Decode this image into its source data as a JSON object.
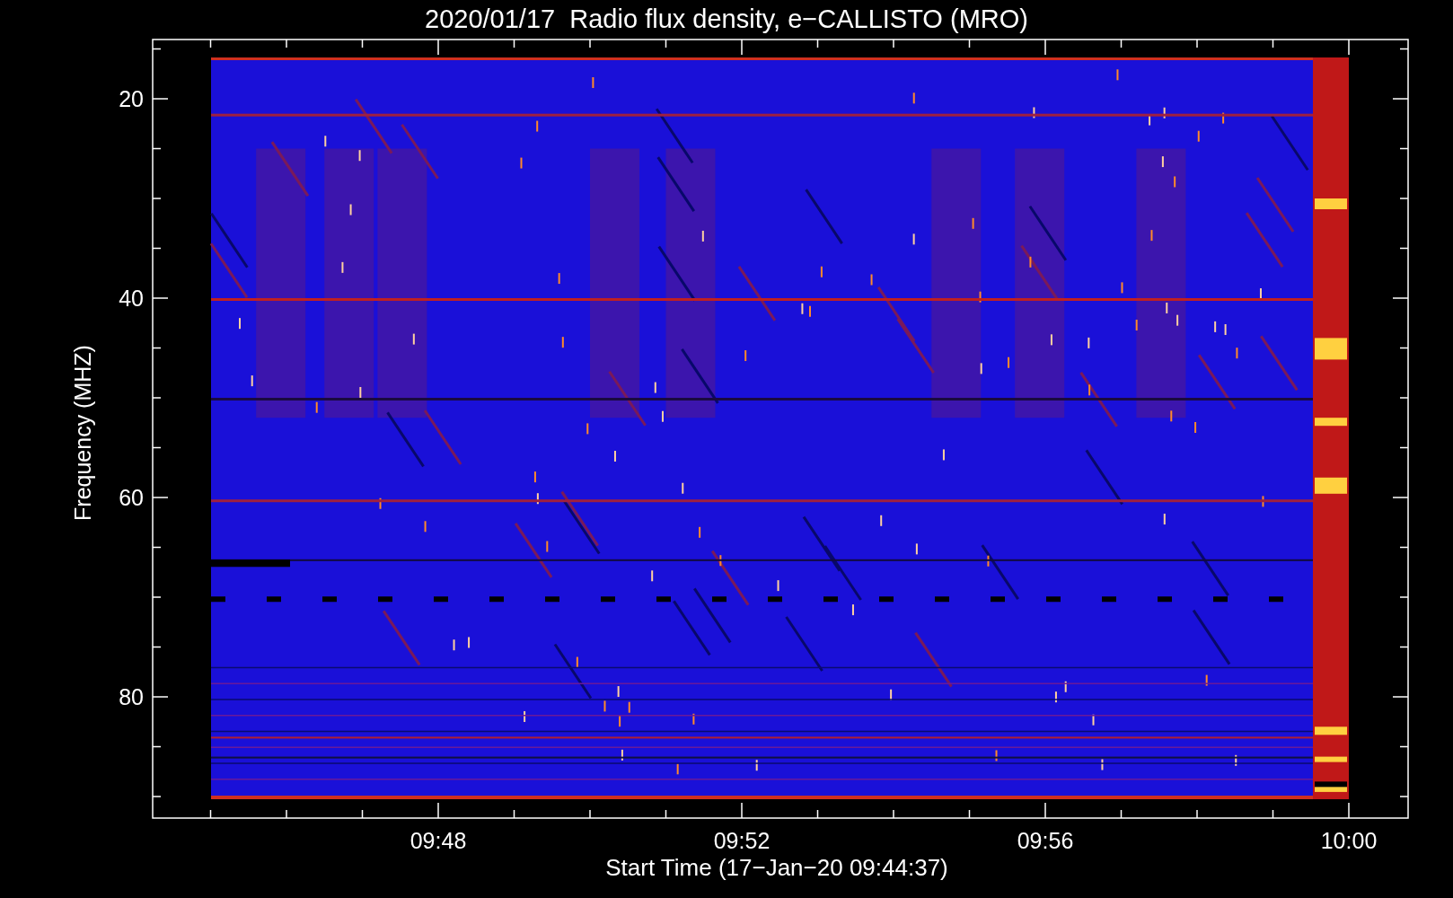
{
  "title": "2020/01/17  Radio flux density, e−CALLISTO (MRO)",
  "y_axis": {
    "label": "Frequency (MHZ)",
    "ticks": [
      "20",
      "40",
      "60",
      "80"
    ]
  },
  "x_axis": {
    "label": "Start Time (17−Jan−20 09:44:37)",
    "ticks": [
      "09:48",
      "09:52",
      "09:56",
      "10:00"
    ]
  }
}
